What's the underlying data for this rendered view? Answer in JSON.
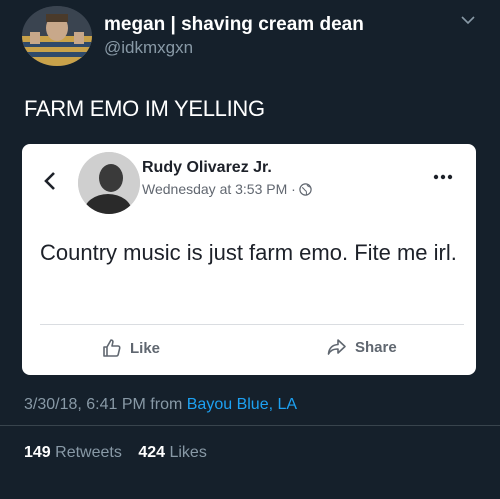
{
  "tweet": {
    "display_name": "megan | shaving cream dean",
    "handle": "@idkmxgxn",
    "text": "FARM EMO IM YELLING",
    "timestamp": "3/30/18, 6:41 PM from ",
    "location": "Bayou Blue, LA",
    "retweets_count": "149",
    "retweets_label": "Retweets",
    "likes_count": "424",
    "likes_label": "Likes"
  },
  "embedded_post": {
    "author": "Rudy Olivarez Jr.",
    "time": "Wednesday at 3:53 PM ·",
    "text": "Country music is just farm emo. Fite me irl.",
    "like_label": "Like",
    "share_label": "Share"
  },
  "colors": {
    "background": "#15202b",
    "link": "#1da1f2",
    "muted": "#8899a6",
    "card": "#ffffff"
  },
  "icons": {
    "chevron": "chevron-down-icon",
    "back": "back-chevron-icon",
    "globe": "globe-icon",
    "more": "more-icon",
    "like": "thumbs-up-icon",
    "share": "share-arrow-icon"
  }
}
